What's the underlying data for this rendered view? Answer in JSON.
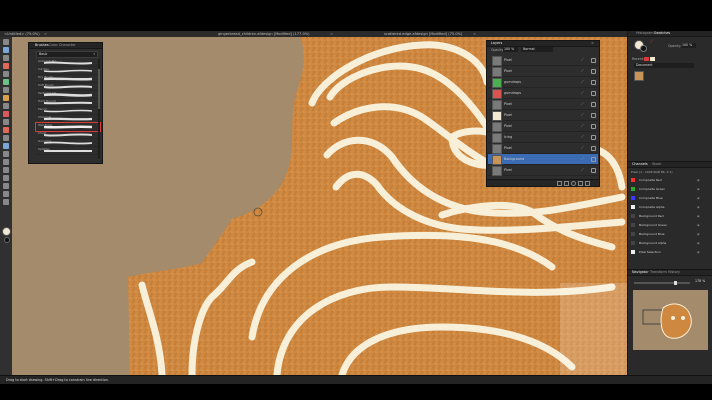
{
  "tabs": [
    {
      "label": "<Untitled> (75.0%)"
    },
    {
      "label": "gingerbread_children.afdesign [Modified] (177.0%)"
    },
    {
      "label": "scattered-edge.afdesign [Modified] (75.0%)"
    }
  ],
  "status_bar": {
    "text": "Drag to start drawing. Shift+Drag to constrain line direction."
  },
  "brushes_panel": {
    "tabs": [
      "Brushes",
      "Color",
      "Character"
    ],
    "category": "Basic",
    "brush_names": [
      "Airbrush Pro",
      "Ink Pen",
      "Dry Brush",
      "Soft Brush",
      "Textured Ink",
      "Hard Round",
      "Pencil",
      "Charcoal",
      "Wet Edge",
      "Chalk",
      "Gouache",
      "Splatter"
    ]
  },
  "layers_panel": {
    "title": "Layers",
    "opacity_label": "Opacity:",
    "opacity_value": "100 %",
    "blend_mode": "Normal",
    "layers": [
      {
        "name": "Pixel",
        "thumb": "#7a7a7a"
      },
      {
        "name": "Pixel",
        "thumb": "#7a7a7a"
      },
      {
        "name": "gumdrops",
        "thumb": "#4caf50"
      },
      {
        "name": "gumdrops",
        "thumb": "#d9534f"
      },
      {
        "name": "Pixel",
        "thumb": "#7a7a7a"
      },
      {
        "name": "Pixel",
        "thumb": "#f2e9d5"
      },
      {
        "name": "Pixel",
        "thumb": "#7a7a7a"
      },
      {
        "name": "Icing",
        "thumb": "#7a7a7a"
      },
      {
        "name": "Pixel",
        "thumb": "#7a7a7a"
      },
      {
        "name": "Background",
        "thumb": "#c8945a"
      },
      {
        "name": "Pixel",
        "thumb": "#7a7a7a"
      }
    ],
    "selected_index": 9
  },
  "right_top": {
    "tabs": [
      "Histogram",
      "Swatches"
    ],
    "opacity_label": "Opacity:",
    "opacity_value": "100 %",
    "document_label": "Document",
    "recent_label": "Recent:",
    "swatch_color": "#c8945a"
  },
  "channels_panel": {
    "tabs": [
      "Channels",
      "Stock"
    ],
    "subtitle": "Pixel (1 - 10LB RGB 8b, 2.1)",
    "channels": [
      {
        "name": "Composite Red",
        "color": "#ff2a2a"
      },
      {
        "name": "Composite Green",
        "color": "#2aaa2a"
      },
      {
        "name": "Composite Blue",
        "color": "#3a3aff"
      },
      {
        "name": "Composite Alpha",
        "color": "#eeeeee"
      },
      {
        "name": "Background Red",
        "color": ""
      },
      {
        "name": "Background Green",
        "color": ""
      },
      {
        "name": "Background Blue",
        "color": ""
      },
      {
        "name": "Background Alpha",
        "color": ""
      },
      {
        "name": "Pixel Selection",
        "color": "#eeeeee"
      }
    ]
  },
  "navigator_panel": {
    "tabs": [
      "Navigator",
      "Transform",
      "History"
    ],
    "zoom_value": "178 %"
  },
  "colors": {
    "cookie": "#cf8840",
    "background": "#a48b6b",
    "icing": "#f8efd8",
    "panel": "#2d2d2d",
    "selection": "#3b6cb3"
  }
}
